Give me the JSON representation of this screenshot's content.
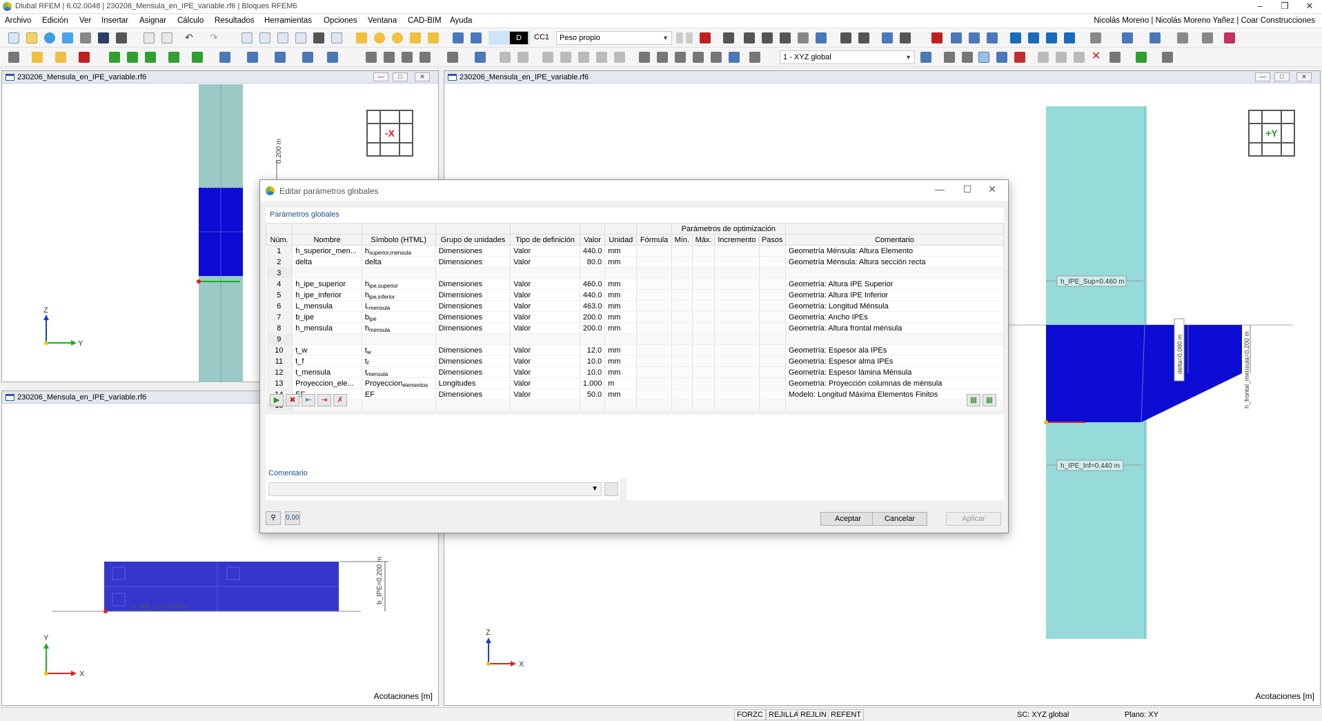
{
  "window": {
    "title": "Dlubal RFEM | 6.02.0048 | 230206_Mensula_en_IPE_variable.rf6 | Bloques RFEM6"
  },
  "menu": {
    "items": [
      "Archivo",
      "Edición",
      "Ver",
      "Insertar",
      "Asignar",
      "Cálculo",
      "Resultados",
      "Herramientas",
      "Opciones",
      "Ventana",
      "CAD-BIM",
      "Ayuda"
    ],
    "user": "Nicolás Moreno | Nicolás Moreno Yañez | Coar Construcciones"
  },
  "toolbar": {
    "load_case_tag": "D",
    "load_case": "CC1",
    "load_case_name": "Peso propio",
    "coord_system": "1 - XYZ global"
  },
  "viewports": {
    "top_left": {
      "title": "230206_Mensula_en_IPE_variable.rf6",
      "cube_label": "-X",
      "dim_text": "0.200 m",
      "axis_v": "Z",
      "axis_h": "Y"
    },
    "bottom_left": {
      "title": "230206_Mensula_en_IPE_variable.rf6",
      "dim_text": "b_IPE=0.200 m",
      "dim_text2": "h_IPE_sup=0.460m",
      "axis_v": "Y",
      "axis_h": "X",
      "footer": "Acotaciones [m]"
    },
    "right": {
      "title": "230206_Mensula_en_IPE_variable.rf6",
      "cube_label": "+Y",
      "dim_sup": "h_IPE_Sup=0.460 m",
      "dim_inf": "h_IPE_Inf=0.440 m",
      "dim_delta": "delta=0.080 m",
      "dim_frontal": "h_frontal_mensula=0.200 m",
      "axis_v": "Z",
      "axis_h": "X",
      "footer": "Acotaciones [m]"
    }
  },
  "dialog": {
    "title": "Editar parámetros globales",
    "section_title": "Parámetros globales",
    "group_header": "Parámetros de optimización",
    "columns": [
      "Núm.",
      "Nombre",
      "Símbolo (HTML)",
      "Grupo de unidades",
      "Tipo de definición",
      "Valor",
      "Unidad",
      "Fórmula",
      "Mín.",
      "Máx.",
      "Incremento",
      "Pasos",
      "Comentario"
    ],
    "rows": [
      {
        "num": "1",
        "nombre": "h_superior_men...",
        "sym_base": "h",
        "sym_sub": "superior,mensula",
        "grupo": "Dimensiones",
        "tipo": "Valor",
        "valor": "440.0",
        "unidad": "mm",
        "comentario": "Geometría Ménsula: Altura Elemento"
      },
      {
        "num": "2",
        "nombre": "delta",
        "sym_base": "delta",
        "sym_sub": "",
        "grupo": "Dimensiones",
        "tipo": "Valor",
        "valor": "80.0",
        "unidad": "mm",
        "comentario": "Geometría Ménsula: Altura sección recta"
      },
      {
        "num": "3",
        "nombre": "",
        "sym_base": "",
        "sym_sub": "",
        "grupo": "",
        "tipo": "",
        "valor": "",
        "unidad": "",
        "comentario": ""
      },
      {
        "num": "4",
        "nombre": "h_ipe_superior",
        "sym_base": "h",
        "sym_sub": "ipe,superior",
        "grupo": "Dimensiones",
        "tipo": "Valor",
        "valor": "460.0",
        "unidad": "mm",
        "comentario": "Geometría: Altura IPE Superior"
      },
      {
        "num": "5",
        "nombre": "h_ipe_inferior",
        "sym_base": "h",
        "sym_sub": "ipe,inferior",
        "grupo": "Dimensiones",
        "tipo": "Valor",
        "valor": "440.0",
        "unidad": "mm",
        "comentario": "Geometría: Altura IPE Inferior"
      },
      {
        "num": "6",
        "nombre": "L_mensula",
        "sym_base": "L",
        "sym_sub": "mensula",
        "grupo": "Dimensiones",
        "tipo": "Valor",
        "valor": "463.0",
        "unidad": "mm",
        "comentario": "Geometría: Longitud Ménsula"
      },
      {
        "num": "7",
        "nombre": "b_ipe",
        "sym_base": "b",
        "sym_sub": "ipe",
        "grupo": "Dimensiones",
        "tipo": "Valor",
        "valor": "200.0",
        "unidad": "mm",
        "comentario": "Geometría: Ancho IPEs"
      },
      {
        "num": "8",
        "nombre": "h_mensula",
        "sym_base": "h",
        "sym_sub": "mensula",
        "grupo": "Dimensiones",
        "tipo": "Valor",
        "valor": "200.0",
        "unidad": "mm",
        "comentario": "Geometría: Altura frontal ménsula"
      },
      {
        "num": "9",
        "nombre": "",
        "sym_base": "",
        "sym_sub": "",
        "grupo": "",
        "tipo": "",
        "valor": "",
        "unidad": "",
        "comentario": ""
      },
      {
        "num": "10",
        "nombre": "t_w",
        "sym_base": "t",
        "sym_sub": "w",
        "grupo": "Dimensiones",
        "tipo": "Valor",
        "valor": "12.0",
        "unidad": "mm",
        "comentario": "Geometría: Espesor ala IPEs"
      },
      {
        "num": "11",
        "nombre": "t_f",
        "sym_base": "t",
        "sym_sub": "f",
        "grupo": "Dimensiones",
        "tipo": "Valor",
        "valor": "10.0",
        "unidad": "mm",
        "comentario": "Geometría: Espesor alma IPEs"
      },
      {
        "num": "12",
        "nombre": "t_mensula",
        "sym_base": "t",
        "sym_sub": "mensula",
        "grupo": "Dimensiones",
        "tipo": "Valor",
        "valor": "10.0",
        "unidad": "mm",
        "comentario": "Geometría: Espesor lámina Ménsula"
      },
      {
        "num": "13",
        "nombre": "Proyeccion_ele...",
        "sym_base": "Proyeccion",
        "sym_sub": "elementos",
        "grupo": "Longitudes",
        "tipo": "Valor",
        "valor": "1.000",
        "unidad": "m",
        "comentario": "Geometría: Proyección columnas de ménsula"
      },
      {
        "num": "14",
        "nombre": "EF",
        "sym_base": "EF",
        "sym_sub": "",
        "grupo": "Dimensiones",
        "tipo": "Valor",
        "valor": "50.0",
        "unidad": "mm",
        "comentario": "Modelo: Longitud Máxima Elementos Finitos"
      },
      {
        "num": "15",
        "nombre": "",
        "sym_base": "",
        "sym_sub": "",
        "grupo": "",
        "tipo": "",
        "valor": "",
        "unidad": "",
        "comentario": ""
      }
    ],
    "comment_label": "Comentario",
    "buttons": {
      "ok": "Aceptar",
      "cancel": "Cancelar",
      "apply": "Aplicar"
    },
    "units_btn": "0,00"
  },
  "statusbar": {
    "toggles": [
      "FORZC",
      "REJILLA",
      "REJLIN",
      "REFENT"
    ],
    "cs": "SC: XYZ global",
    "plane": "Plano: XY"
  },
  "colors": {
    "member_blue": "#0c0cd4",
    "column_cyan": "#96dada",
    "axis_red": "#e02020",
    "axis_green": "#18b018",
    "axis_blue": "#1a3ad8"
  }
}
